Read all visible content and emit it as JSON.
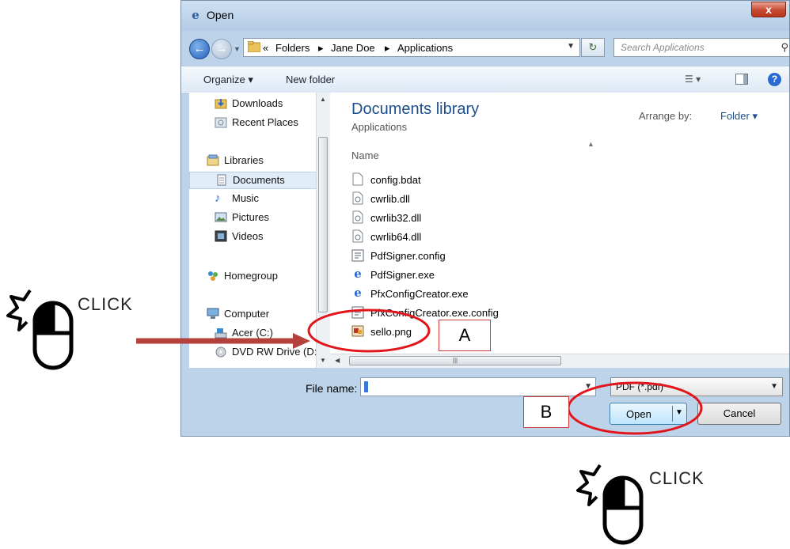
{
  "window": {
    "title": "Open",
    "close_symbol": "x"
  },
  "address_bar": {
    "crumbs": [
      "«",
      "Folders",
      "▸",
      "Jane Doe",
      "▸",
      "Applications"
    ],
    "search_placeholder": "Search Applications"
  },
  "toolbar": {
    "organize_label": "Organize ▾",
    "new_folder_label": "New folder"
  },
  "nav_pane": {
    "items": [
      {
        "label": "Downloads",
        "icon": "downloads-folder-icon"
      },
      {
        "label": "Recent Places",
        "icon": "recent-places-icon"
      },
      {
        "label": "Libraries",
        "icon": "libraries-icon"
      },
      {
        "label": "Documents",
        "icon": "documents-icon",
        "selected": true
      },
      {
        "label": "Music",
        "icon": "music-icon"
      },
      {
        "label": "Pictures",
        "icon": "pictures-icon"
      },
      {
        "label": "Videos",
        "icon": "videos-icon"
      },
      {
        "label": "Homegroup",
        "icon": "homegroup-icon"
      },
      {
        "label": "Computer",
        "icon": "computer-icon"
      },
      {
        "label": "Acer (C:)",
        "icon": "drive-icon"
      },
      {
        "label": "DVD RW Drive (D:",
        "icon": "dvd-drive-icon"
      }
    ]
  },
  "content": {
    "library_title": "Documents library",
    "library_subtitle": "Applications",
    "arrange_by_label": "Arrange by:",
    "arrange_by_value": "Folder ▾",
    "column_name": "Name",
    "files": [
      {
        "name": "config.bdat",
        "icon": "blank-file-icon"
      },
      {
        "name": "cwrlib.dll",
        "icon": "dll-file-icon"
      },
      {
        "name": "cwrlib32.dll",
        "icon": "dll-file-icon"
      },
      {
        "name": "cwrlib64.dll",
        "icon": "dll-file-icon"
      },
      {
        "name": "PdfSigner.config",
        "icon": "config-file-icon"
      },
      {
        "name": "PdfSigner.exe",
        "icon": "ie-exe-icon"
      },
      {
        "name": "PfxConfigCreator.exe",
        "icon": "ie-exe-icon"
      },
      {
        "name": "PfxConfigCreator.exe.config",
        "icon": "config-file-icon"
      },
      {
        "name": "sello.png",
        "icon": "png-file-icon"
      }
    ]
  },
  "bottom": {
    "file_name_label": "File name:",
    "file_type_value": "PDF (*.pdf)",
    "open_label": "Open",
    "cancel_label": "Cancel"
  },
  "annotations": {
    "callout_a": "A",
    "callout_b": "B",
    "click_text": "CLICK",
    "colors": {
      "arrow": "#b5413d",
      "ellipse": "#e0161c"
    }
  }
}
